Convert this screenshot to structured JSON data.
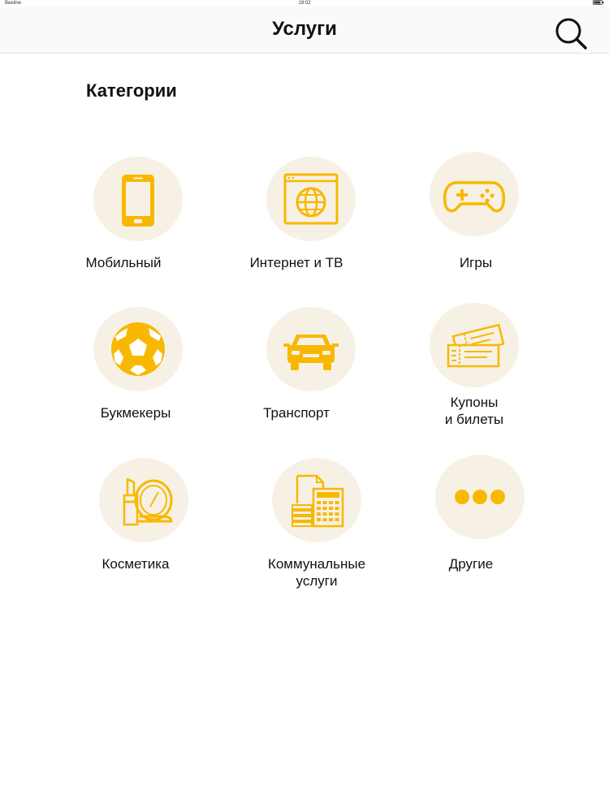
{
  "status_bar": {
    "carrier": "Beeline",
    "time": "19:02",
    "battery": ""
  },
  "header": {
    "title": "Услуги",
    "search_icon": "search-icon"
  },
  "categories_title": "Категории",
  "accent_color": "#f8b800",
  "circle_color": "#f7f1e5",
  "categories": [
    {
      "label": "Мобильный",
      "icon": "mobile-phone-icon"
    },
    {
      "label": "Интернет и ТВ",
      "icon": "internet-globe-icon"
    },
    {
      "label": "Игры",
      "icon": "gamepad-icon"
    },
    {
      "label": "Букмекеры",
      "icon": "soccer-ball-icon"
    },
    {
      "label": "Транспорт",
      "icon": "car-icon"
    },
    {
      "label": "Купоны\nи билеты",
      "icon": "tickets-icon"
    },
    {
      "label": "Косметика",
      "icon": "cosmetics-icon"
    },
    {
      "label": "Коммунальные\nуслуги",
      "icon": "utility-bills-icon"
    },
    {
      "label": "Другие",
      "icon": "more-dots-icon"
    }
  ]
}
